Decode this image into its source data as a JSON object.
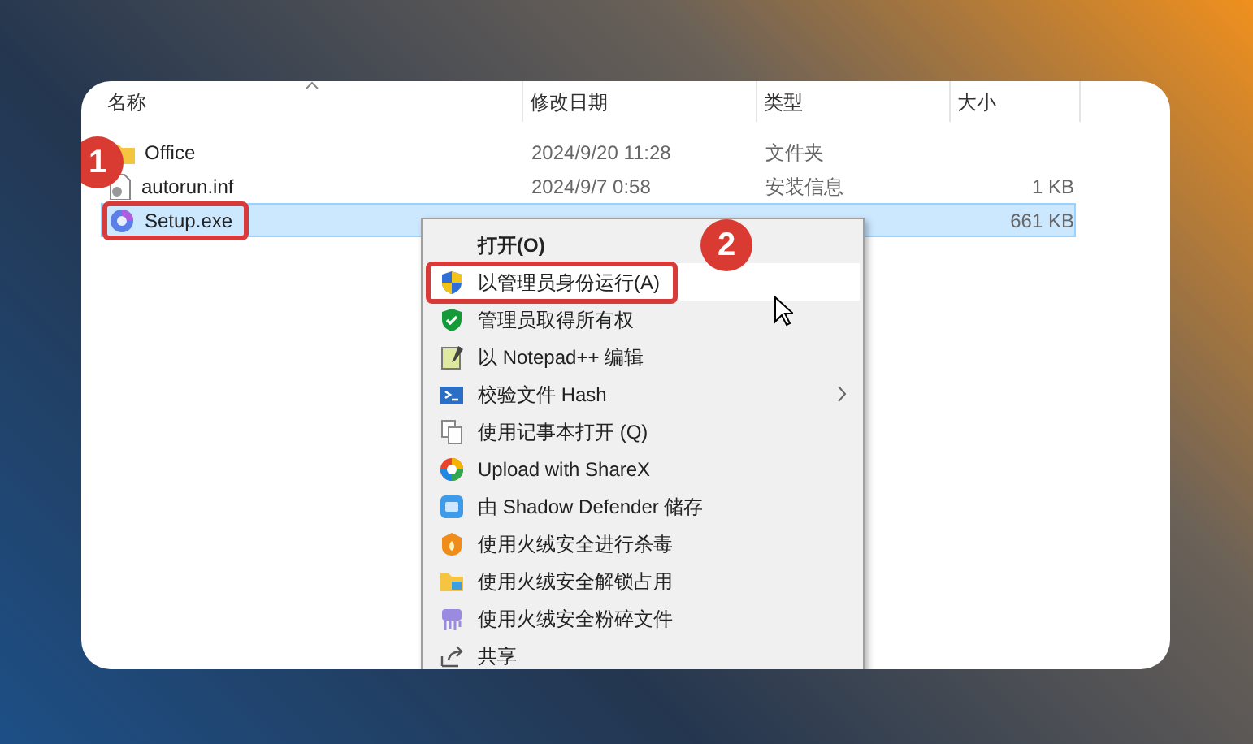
{
  "columns": [
    {
      "label": "名称",
      "sorted": true
    },
    {
      "label": "修改日期",
      "sorted": false
    },
    {
      "label": "类型",
      "sorted": false
    },
    {
      "label": "大小",
      "sorted": false
    }
  ],
  "files": [
    {
      "kind": "folder",
      "name": "Office",
      "date": "2024/9/20 11:28",
      "type": "文件夹",
      "selected": false
    },
    {
      "kind": "file",
      "name": "autorun.inf",
      "date": "2024/9/7 0:58",
      "type": "安装信息",
      "size": "1 KB",
      "selected": false
    },
    {
      "kind": "app",
      "name": "Setup.exe",
      "size": "661 KB",
      "selected": true
    }
  ],
  "context_menu": [
    {
      "label": "打开(O)",
      "default": true,
      "selected": false,
      "submenu": false
    },
    {
      "label": "以管理员身份运行(A)",
      "default": false,
      "selected": true,
      "submenu": false
    },
    {
      "label": "管理员取得所有权",
      "default": false,
      "selected": false,
      "submenu": false
    },
    {
      "label": "以 Notepad++ 编辑",
      "default": false,
      "selected": false,
      "submenu": false
    },
    {
      "label": "校验文件 Hash",
      "default": false,
      "selected": false,
      "submenu": true
    },
    {
      "label": "使用记事本打开 (Q)",
      "default": false,
      "selected": false,
      "submenu": false
    },
    {
      "label": "Upload with ShareX",
      "default": false,
      "selected": false,
      "submenu": false
    },
    {
      "label": "由 Shadow Defender 储存",
      "default": false,
      "selected": false,
      "submenu": false
    },
    {
      "label": "使用火绒安全进行杀毒",
      "default": false,
      "selected": false,
      "submenu": false
    },
    {
      "label": "使用火绒安全解锁占用",
      "default": false,
      "selected": false,
      "submenu": false
    },
    {
      "label": "使用火绒安全粉碎文件",
      "default": false,
      "selected": false,
      "submenu": false
    },
    {
      "label": "共享",
      "default": false,
      "selected": false,
      "submenu": false
    }
  ],
  "step_badges": [
    "1",
    "2"
  ]
}
